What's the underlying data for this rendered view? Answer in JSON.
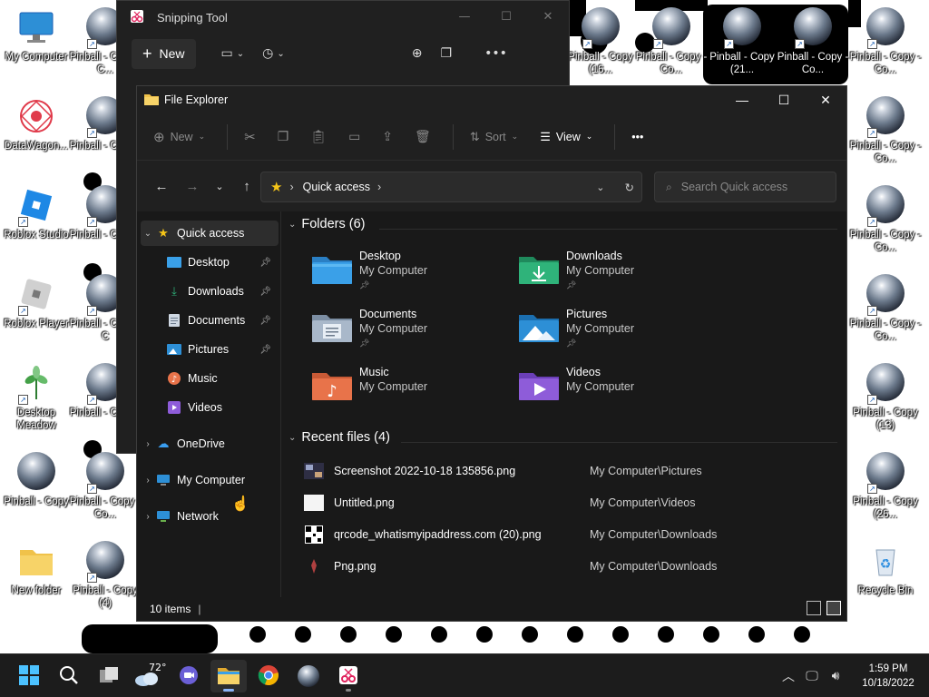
{
  "desktop": {
    "left_icons": [
      {
        "label": "My Computer"
      },
      {
        "label": "DataWagon..."
      },
      {
        "label": "Roblox Studio"
      },
      {
        "label": "Roblox Player"
      },
      {
        "label": "Desktop Meadow"
      },
      {
        "label": "Pinball - Copy"
      },
      {
        "label": "New folder"
      }
    ],
    "col2_icons": [
      {
        "label": "Pinball - Copy - C..."
      },
      {
        "label": "Pinball - Copy ("
      },
      {
        "label": "Pinball - Copy ("
      },
      {
        "label": "Pinball - Copy - C"
      },
      {
        "label": "Pinball - Copy ("
      },
      {
        "label": "Pinball - Copy - Co..."
      },
      {
        "label": "Pinball - Copy (4)"
      }
    ],
    "top_icons": [
      {
        "label": "Pinball - Copy (16..."
      },
      {
        "label": "Pinball - Copy - Co..."
      },
      {
        "label": "Pinball - Copy (21..."
      },
      {
        "label": "Pinball - Copy - Co..."
      }
    ],
    "right_icons": [
      {
        "label": "Pinball - Copy - Co..."
      },
      {
        "label": "Pinball - Copy - Co..."
      },
      {
        "label": "Pinball - Copy - Co..."
      },
      {
        "label": "Pinball - Copy - Co..."
      },
      {
        "label": "Pinball - Copy (13)"
      },
      {
        "label": "Pinball - Copy (26..."
      },
      {
        "label": "Recycle Bin"
      }
    ]
  },
  "snipping_tool": {
    "title": "Snipping Tool",
    "new_label": "New"
  },
  "explorer": {
    "title": "File Explorer",
    "cmd": {
      "new": "New",
      "sort": "Sort",
      "view": "View"
    },
    "address": {
      "location": "Quick access"
    },
    "search_placeholder": "Search Quick access",
    "sidebar": {
      "quick_access": "Quick access",
      "items": [
        {
          "label": "Desktop",
          "pinned": true
        },
        {
          "label": "Downloads",
          "pinned": true
        },
        {
          "label": "Documents",
          "pinned": true
        },
        {
          "label": "Pictures",
          "pinned": true
        },
        {
          "label": "Music",
          "pinned": false
        },
        {
          "label": "Videos",
          "pinned": false
        }
      ],
      "onedrive": "OneDrive",
      "my_computer": "My Computer",
      "network": "Network"
    },
    "folders_header": "Folders (6)",
    "folders": [
      {
        "name": "Desktop",
        "location": "My Computer",
        "pinned": true
      },
      {
        "name": "Downloads",
        "location": "My Computer",
        "pinned": true
      },
      {
        "name": "Documents",
        "location": "My Computer",
        "pinned": true
      },
      {
        "name": "Pictures",
        "location": "My Computer",
        "pinned": true
      },
      {
        "name": "Music",
        "location": "My Computer",
        "pinned": false
      },
      {
        "name": "Videos",
        "location": "My Computer",
        "pinned": false
      }
    ],
    "recent_header": "Recent files (4)",
    "recent": [
      {
        "name": "Screenshot 2022-10-18 135856.png",
        "location": "My Computer\\Pictures"
      },
      {
        "name": "Untitled.png",
        "location": "My Computer\\Videos"
      },
      {
        "name": "qrcode_whatismyipaddress.com (20).png",
        "location": "My Computer\\Downloads"
      },
      {
        "name": "Png.png",
        "location": "My Computer\\Downloads"
      }
    ],
    "status": "10 items"
  },
  "taskbar": {
    "weather_temp": "72°",
    "time": "1:59 PM",
    "date": "10/18/2022"
  },
  "colors": {
    "accent": "#8ab4f8",
    "folder_blue": "#3aa0e8",
    "folder_green": "#2fb37a"
  }
}
